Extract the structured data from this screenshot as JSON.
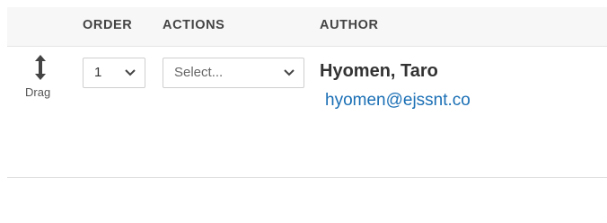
{
  "table": {
    "headers": {
      "order": "ORDER",
      "actions": "ACTIONS",
      "author": "AUTHOR"
    },
    "rows": [
      {
        "drag_label": "Drag",
        "order_value": "1",
        "actions_placeholder": "Select...",
        "author_name": "Hyomen, Taro",
        "author_email": "hyomen@ejssnt.co"
      }
    ]
  },
  "icons": {
    "drag": "vertical-resize-arrow-icon",
    "dropdown": "chevron-down-icon"
  },
  "colors": {
    "header_bg": "#f7f7f7",
    "link": "#1a6fb5",
    "text": "#333333",
    "border": "#cfcfcf"
  }
}
